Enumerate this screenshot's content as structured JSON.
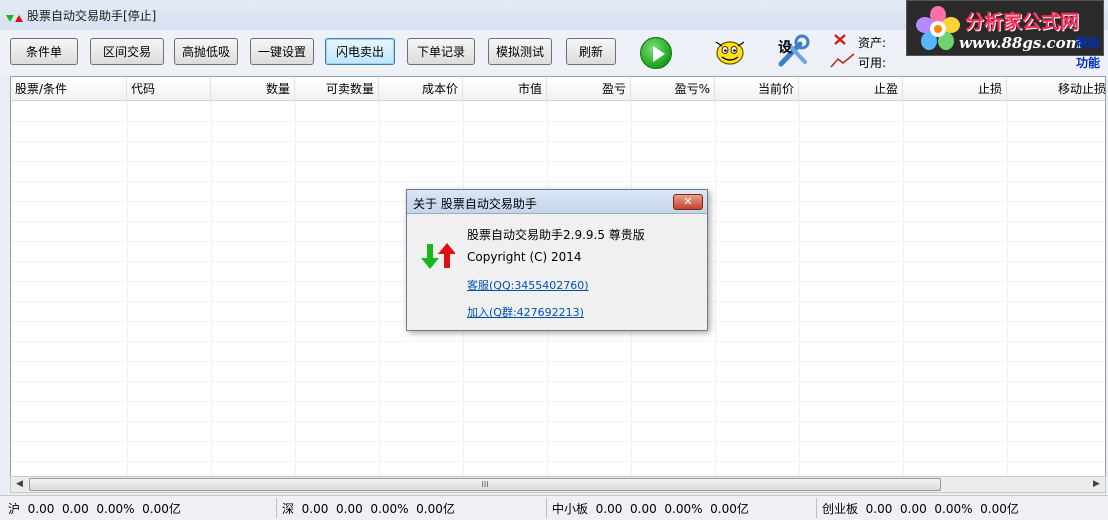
{
  "window": {
    "title": "股票自动交易助手[停止]"
  },
  "toolbar": {
    "buttons": [
      "条件单",
      "区间交易",
      "高抛低吸",
      "一键设置",
      "闪电卖出",
      "下单记录",
      "模拟测试",
      "刷新"
    ]
  },
  "account": {
    "asset_label": "资产:",
    "available_label": "可用:"
  },
  "logo": {
    "title": "分析家公式网",
    "url": "www.88gs.com"
  },
  "side_links": {
    "help": "帮助",
    "features": "功能"
  },
  "table": {
    "columns": [
      "股票/条件",
      "代码",
      "数量",
      "可卖数量",
      "成本价",
      "市值",
      "盈亏",
      "盈亏%",
      "当前价",
      "止盈",
      "止损",
      "移动止损"
    ]
  },
  "scrollbar": {
    "grip": "III"
  },
  "status": {
    "markets": [
      {
        "name": "沪",
        "v1": "0.00",
        "v2": "0.00",
        "pct": "0.00%",
        "amount": "0.00亿"
      },
      {
        "name": "深",
        "v1": "0.00",
        "v2": "0.00",
        "pct": "0.00%",
        "amount": "0.00亿"
      },
      {
        "name": "中小板",
        "v1": "0.00",
        "v2": "0.00",
        "pct": "0.00%",
        "amount": "0.00亿"
      },
      {
        "name": "创业板",
        "v1": "0.00",
        "v2": "0.00",
        "pct": "0.00%",
        "amount": "0.00亿"
      }
    ]
  },
  "about_dialog": {
    "title": "关于 股票自动交易助手",
    "product": "股票自动交易助手2.9.9.5 尊贵版",
    "copyright": "Copyright (C) 2014",
    "support_link": "客服(QQ:3455402760)",
    "join_link": "加入(Q群:427692213)",
    "close_label": "✕"
  },
  "colors": {
    "up": "#e01010",
    "down": "#17b81a",
    "link": "#0050b0"
  }
}
